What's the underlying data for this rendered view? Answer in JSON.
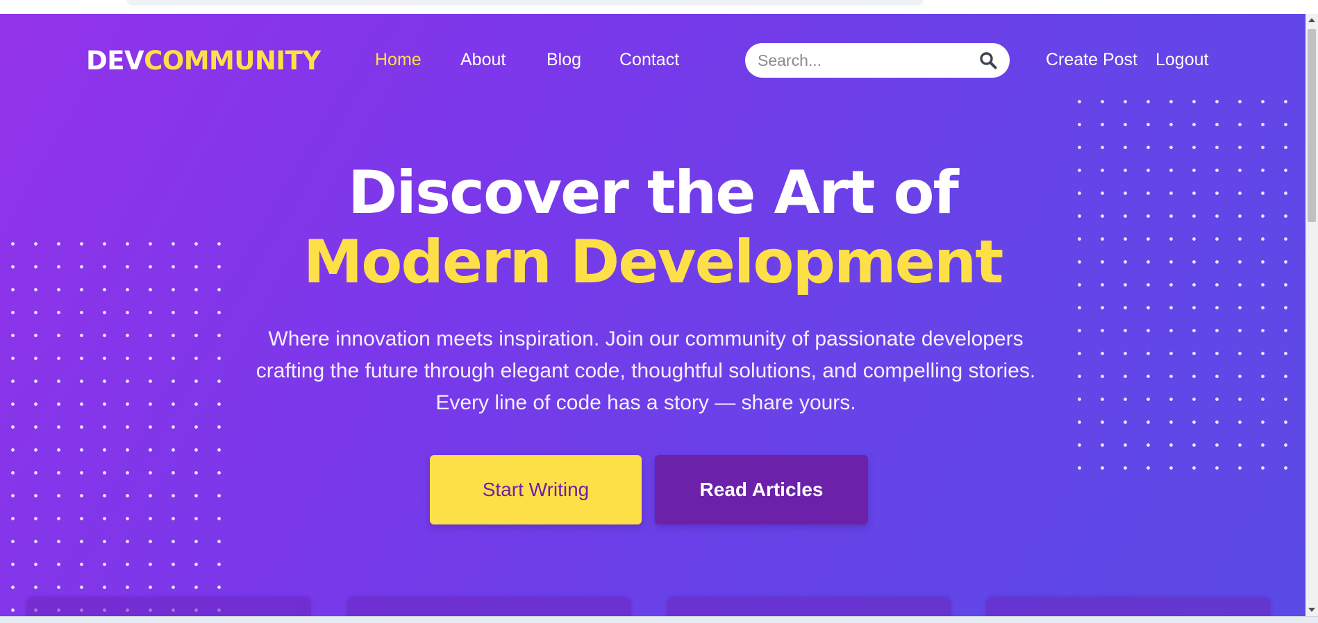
{
  "brand": {
    "part1": "DEV",
    "part2": "COMMUNITY"
  },
  "nav": {
    "links": [
      {
        "label": "Home",
        "active": true
      },
      {
        "label": "About",
        "active": false
      },
      {
        "label": "Blog",
        "active": false
      },
      {
        "label": "Contact",
        "active": false
      }
    ],
    "search": {
      "placeholder": "Search...",
      "value": ""
    },
    "create_post": "Create Post",
    "logout": "Logout"
  },
  "hero": {
    "title_line1": "Discover the Art of",
    "title_line2": "Modern Development",
    "description_lines": [
      "Where innovation meets inspiration. Join our community of passionate developers",
      "crafting the future through elegant code, thoughtful solutions, and compelling stories.",
      "Every line of code has a story — share yours."
    ],
    "primary_button": "Start Writing",
    "secondary_button": "Read Articles"
  },
  "icons": {
    "search": "search-icon"
  },
  "colors": {
    "gradient_start": "#9333ea",
    "gradient_end": "#5b4ae6",
    "accent_yellow": "#fde047",
    "deep_purple": "#6b21a8",
    "white": "#ffffff"
  }
}
